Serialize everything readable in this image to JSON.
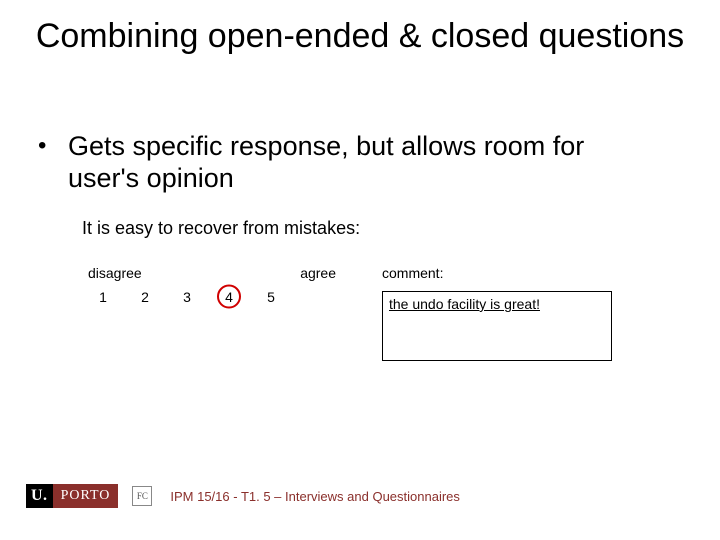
{
  "title": "Combining open-ended & closed questions",
  "bullet": "Gets specific response, but allows room for user's opinion",
  "example": {
    "prompt": "It is easy to recover from mistakes:",
    "scale_low": "disagree",
    "scale_high": "agree",
    "n1": "1",
    "n2": "2",
    "n3": "3",
    "n4": "4",
    "n5": "5",
    "comment_label": "comment:",
    "comment_text": "the undo facility is great!"
  },
  "footer": {
    "logo_u": "U.",
    "logo_porto": "PORTO",
    "fc": "FC",
    "text": "IPM 15/16 - T1. 5 – Interviews and Questionnaires"
  }
}
